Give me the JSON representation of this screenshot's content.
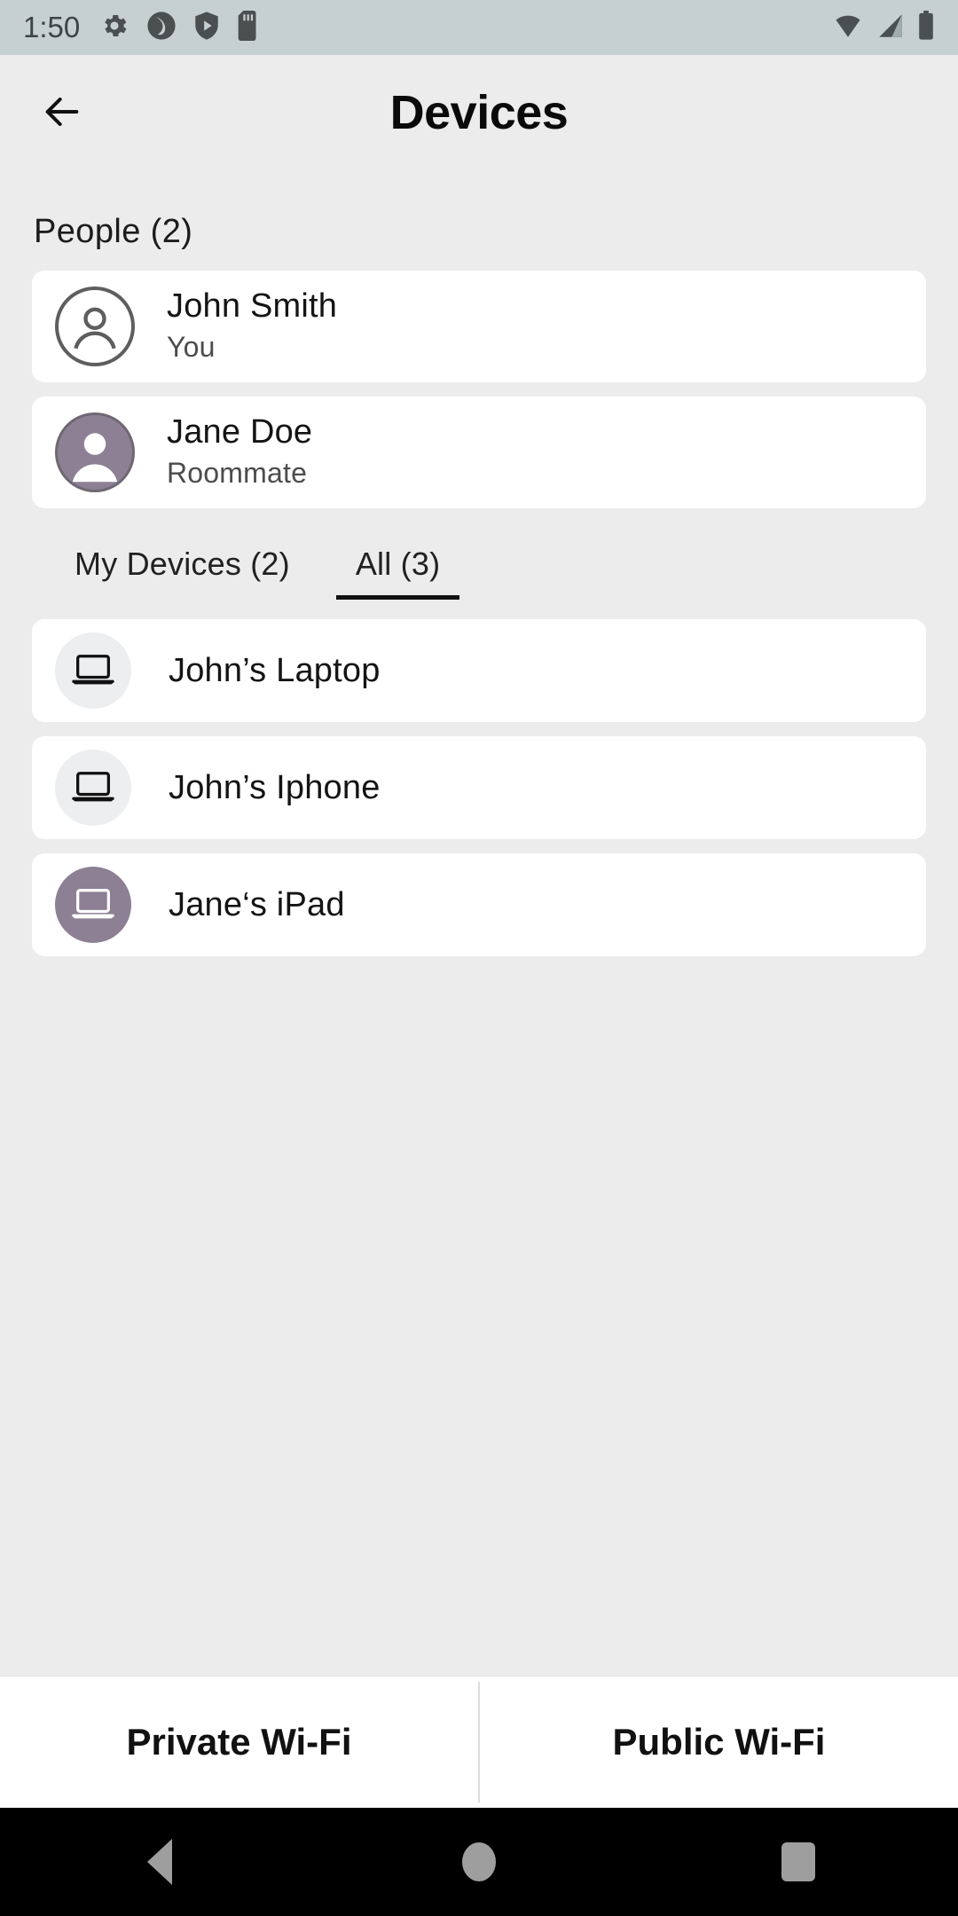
{
  "statusbar": {
    "time": "1:50",
    "left_icons": [
      "gear-icon",
      "app-circle-icon",
      "shield-play-icon",
      "sd-card-icon"
    ],
    "right_icons": [
      "wifi-icon",
      "cellular-signal-icon",
      "battery-icon"
    ]
  },
  "header": {
    "back_icon": "back-arrow-icon",
    "title": "Devices"
  },
  "people_section": {
    "label": "People (2)",
    "items": [
      {
        "name": "John Smith",
        "role": "You",
        "avatar_style": "outline",
        "avatar_color": "#5e5e5e"
      },
      {
        "name": "Jane Doe",
        "role": "Roommate",
        "avatar_style": "filled",
        "avatar_color": "#8d8094"
      }
    ]
  },
  "tabs": [
    {
      "label": "My Devices (2)",
      "active": false
    },
    {
      "label": "All (3)",
      "active": true
    }
  ],
  "devices": [
    {
      "name": "John’s Laptop",
      "icon": "laptop-icon",
      "icon_bg": "grey"
    },
    {
      "name": "John’s Iphone",
      "icon": "laptop-icon",
      "icon_bg": "grey"
    },
    {
      "name": "Jane‘s iPad",
      "icon": "laptop-icon",
      "icon_bg": "purple"
    }
  ],
  "bottom_bar": {
    "private_label": "Private Wi-Fi",
    "public_label": "Public Wi-Fi"
  },
  "navbar": {
    "back": "nav-back-icon",
    "home": "nav-home-icon",
    "recents": "nav-recents-icon"
  },
  "colors": {
    "page_bg": "#ececec",
    "card_bg": "#ffffff",
    "statusbar_bg": "#c7d0d0",
    "accent_purple": "#8d8094",
    "text_primary": "#141414",
    "text_secondary": "#4c4c4c",
    "navbar_bg": "#000000"
  }
}
